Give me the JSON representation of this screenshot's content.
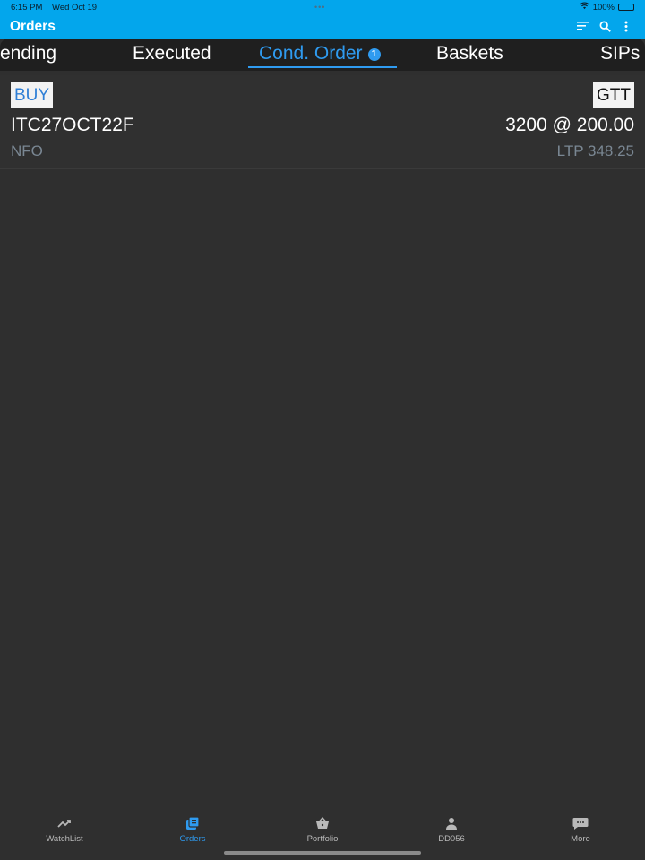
{
  "status_bar": {
    "time": "6:15 PM",
    "date": "Wed Oct 19",
    "battery": "100%"
  },
  "header": {
    "title": "Orders",
    "icons": [
      "sort-icon",
      "search-icon",
      "more-vertical-icon"
    ]
  },
  "tabs": [
    {
      "label": "ending"
    },
    {
      "label": "Executed"
    },
    {
      "label": "Cond. Order",
      "badge": "1",
      "active": true
    },
    {
      "label": "Baskets"
    },
    {
      "label": "SIPs"
    }
  ],
  "order": {
    "side": "BUY",
    "type": "GTT",
    "symbol": "ITC27OCT22F",
    "qty_price": "3200 @ 200.00",
    "exchange": "NFO",
    "ltp": "LTP 348.25"
  },
  "bottom_nav": [
    {
      "label": "WatchList",
      "icon": "trend-icon"
    },
    {
      "label": "Orders",
      "icon": "orders-icon",
      "active": true
    },
    {
      "label": "Portfolio",
      "icon": "basket-icon"
    },
    {
      "label": "DD056",
      "icon": "user-icon"
    },
    {
      "label": "More",
      "icon": "chat-more-icon"
    }
  ],
  "colors": {
    "header": "#03a6ec",
    "accent": "#2f9bf0",
    "background": "#2f2f2f",
    "tabbar": "#1f1f1f"
  }
}
